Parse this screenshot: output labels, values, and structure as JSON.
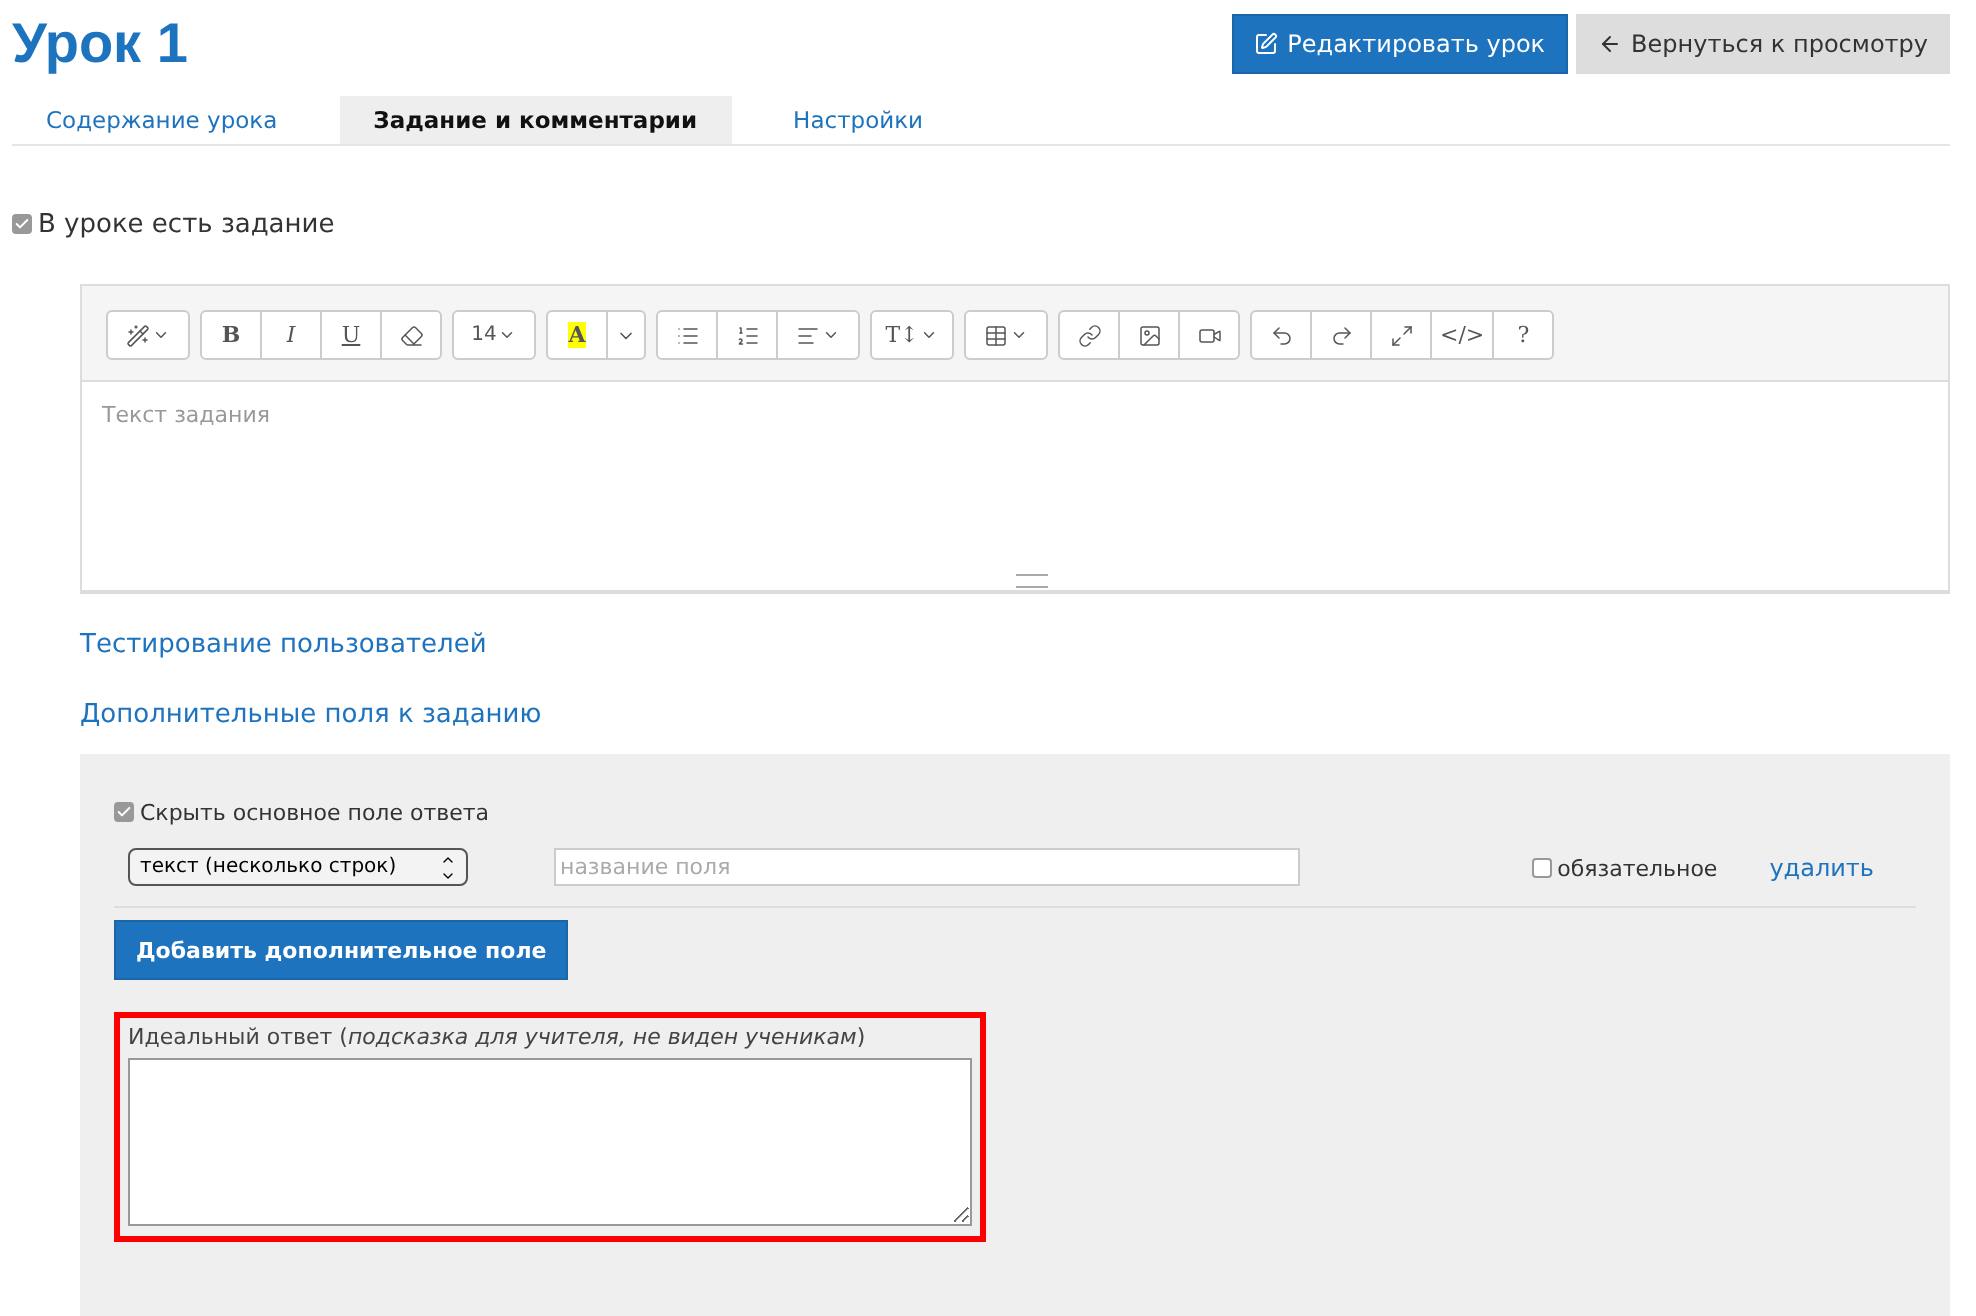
{
  "title": "Урок 1",
  "header_buttons": [
    {
      "kind": "edit",
      "label": "Редактировать урок"
    },
    {
      "kind": "back",
      "label": "Вернуться к просмотру"
    }
  ],
  "tabs": [
    {
      "label": "Содержание урока",
      "selected": false
    },
    {
      "label": "Задание и комментарии",
      "selected": true
    },
    {
      "label": "Настройки",
      "selected": false
    }
  ],
  "has_task": {
    "label": "В уроке есть задание",
    "checked": true
  },
  "editor": {
    "toolbar": [
      [
        {
          "kind": "magic"
        }
      ],
      [
        {
          "kind": "bold",
          "label": "B"
        },
        {
          "kind": "italic",
          "label": "I"
        },
        {
          "kind": "underline",
          "label": "U"
        },
        {
          "kind": "eraser"
        }
      ],
      [
        {
          "kind": "fontsize",
          "label": "14"
        }
      ],
      [
        {
          "kind": "color",
          "label": "A"
        },
        {
          "kind": "caret"
        }
      ],
      [
        {
          "kind": "ul"
        },
        {
          "kind": "ol"
        },
        {
          "kind": "align"
        }
      ],
      [
        {
          "kind": "textheight",
          "label": "T↕"
        }
      ],
      [
        {
          "kind": "table"
        }
      ],
      [
        {
          "kind": "link"
        },
        {
          "kind": "image"
        },
        {
          "kind": "video"
        }
      ],
      [
        {
          "kind": "undo"
        },
        {
          "kind": "redo"
        },
        {
          "kind": "fullscreen"
        },
        {
          "kind": "code",
          "label": "</>"
        },
        {
          "kind": "help",
          "label": "?"
        }
      ]
    ],
    "placeholder": "Текст задания"
  },
  "links": [
    "Тестирование пользователей",
    "Дополнительные поля к заданию"
  ],
  "extra": {
    "hide_main": {
      "label": "Скрыть основное поле ответа",
      "checked": true
    },
    "field": {
      "type": "текст (несколько строк)",
      "name_placeholder": "название поля",
      "required": {
        "label": "обязательное",
        "checked": false
      },
      "delete": "удалить"
    },
    "add_button": "Добавить дополнительное поле",
    "ideal_answer": {
      "label": "Идеальный ответ (*подсказка для учителя, не виден ученикам*)",
      "highlighted": true
    }
  }
}
